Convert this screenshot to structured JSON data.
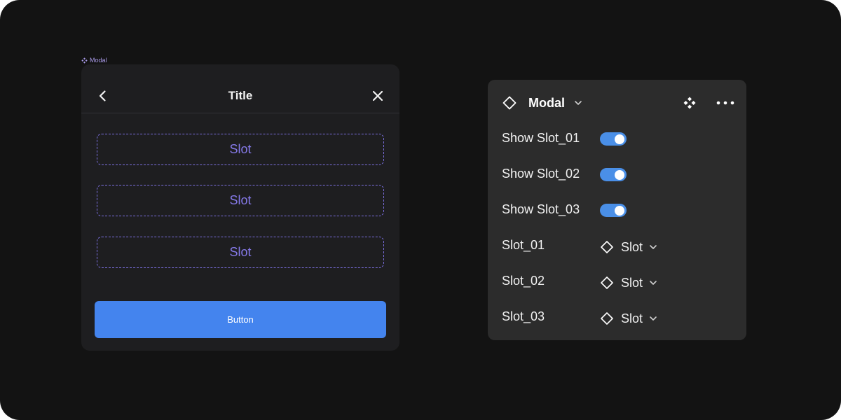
{
  "colors": {
    "canvas_bg": "#131313",
    "modal_bg": "#1e1e20",
    "panel_bg": "#2c2c2c",
    "slot_accent": "#7b6fe0",
    "button_blue": "#4484ee",
    "toggle_on": "#4a8fe7",
    "tag_purple": "#a99ae8"
  },
  "component_tag": {
    "icon": "component-icon",
    "label": "Modal"
  },
  "modal": {
    "back_icon": "chevron-left-icon",
    "title": "Title",
    "close_icon": "close-icon",
    "slots": [
      "Slot",
      "Slot",
      "Slot"
    ],
    "button_label": "Button"
  },
  "panel": {
    "icon": "instance-diamond-icon",
    "title": "Modal",
    "title_dropdown_icon": "chevron-down-icon",
    "goto_main_icon": "component-icon",
    "more_icon": "more-horizontal-icon",
    "toggles": [
      {
        "label": "Show Slot_01",
        "on": true
      },
      {
        "label": "Show Slot_02",
        "on": true
      },
      {
        "label": "Show Slot_03",
        "on": true
      }
    ],
    "swaps": [
      {
        "label": "Slot_01",
        "value": "Slot",
        "icon": "instance-diamond-icon"
      },
      {
        "label": "Slot_02",
        "value": "Slot",
        "icon": "instance-diamond-icon"
      },
      {
        "label": "Slot_03",
        "value": "Slot",
        "icon": "instance-diamond-icon"
      }
    ]
  }
}
